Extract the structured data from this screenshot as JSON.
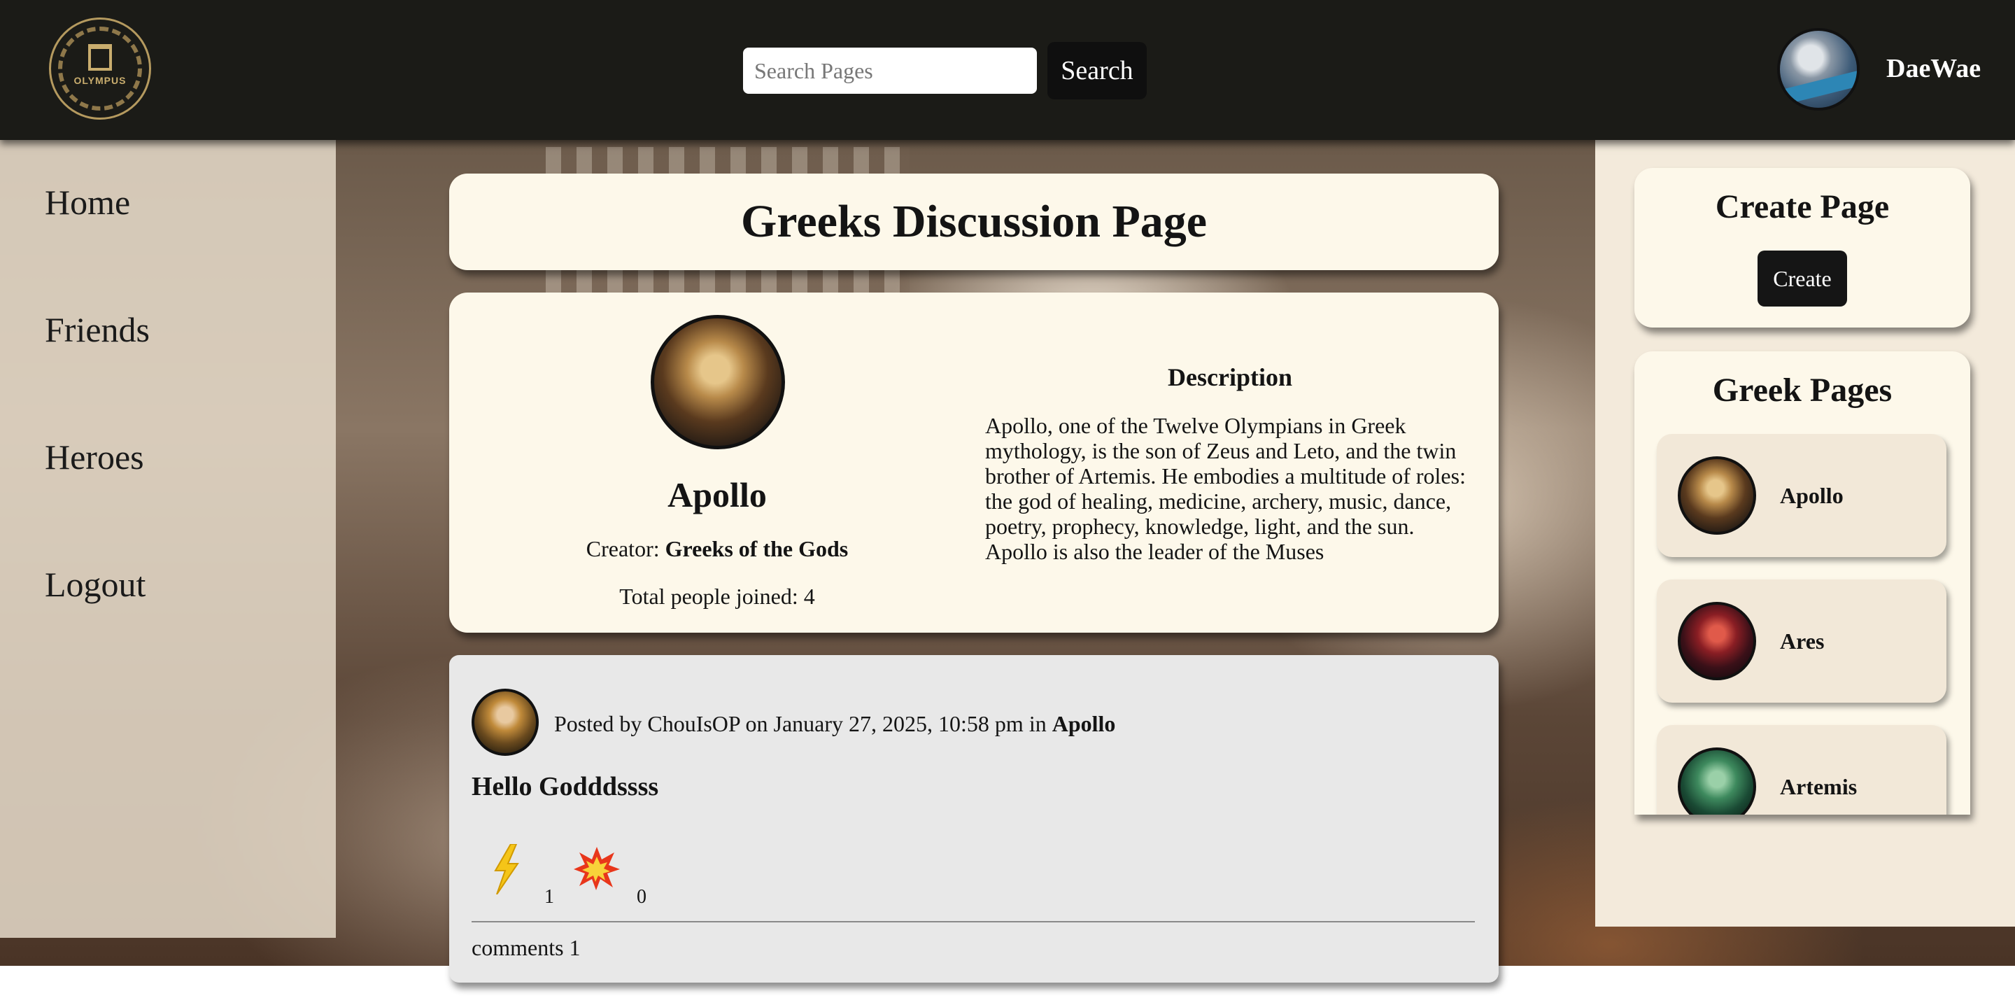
{
  "header": {
    "logo_text": "OLYMPUS",
    "search_placeholder": "Search Pages",
    "search_button": "Search",
    "username": "DaeWae"
  },
  "nav": {
    "items": [
      {
        "label": "Home"
      },
      {
        "label": "Friends"
      },
      {
        "label": "Heroes"
      },
      {
        "label": "Logout"
      }
    ]
  },
  "page": {
    "title": "Greeks Discussion Page",
    "god_name": "Apollo",
    "creator_label": "Creator: ",
    "creator_name": "Greeks of the Gods",
    "joined": "Total people joined: 4",
    "description_heading": "Description",
    "description": "Apollo, one of the Twelve Olympians in Greek mythology, is the son of Zeus and Leto, and the twin brother of Artemis. He embodies a multitude of roles: the god of healing, medicine, archery, music, dance, poetry, prophecy, knowledge, light, and the sun. Apollo is also the leader of the Muses"
  },
  "post": {
    "meta_prefix": "Posted by ChouIsOP on January 27, 2025, 10:58 pm in ",
    "meta_page": "Apollo",
    "title": "Hello Godddssss",
    "reactions": [
      {
        "icon": "lightning-icon",
        "count": "1"
      },
      {
        "icon": "explosion-icon",
        "count": "0"
      }
    ],
    "comments": "comments 1"
  },
  "sidebar": {
    "create_title": "Create Page",
    "create_button": "Create",
    "pages_title": "Greek Pages",
    "pages": [
      {
        "name": "Apollo"
      },
      {
        "name": "Ares"
      },
      {
        "name": "Artemis"
      }
    ]
  }
}
